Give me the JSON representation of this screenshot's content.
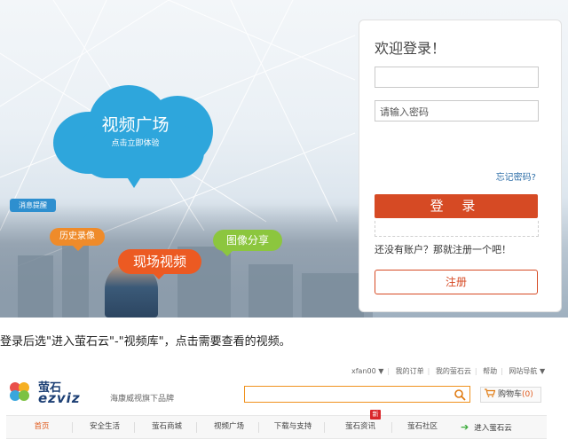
{
  "login_screenshot": {
    "cloud_title": "视频广场",
    "cloud_subtitle": "点击立即体验",
    "tags": {
      "message": "消息提醒",
      "history": "历史录像",
      "live": "现场视频",
      "share": "图像分享"
    },
    "panel": {
      "title": "欢迎登录！",
      "username_value": "",
      "password_placeholder": "请输入密码",
      "forgot_link": "忘记密码?",
      "login_button": "登 录",
      "no_account_text": "还没有账户？那就注册一个吧！",
      "register_button": "注册"
    }
  },
  "caption": "登录后选\"进入萤石云\"-\"视频库\"，点击需要查看的视频。",
  "portal": {
    "top_links": [
      "xfan00 ▼",
      "我的订单",
      "我的萤石云",
      "帮助",
      "网站导航 ▼"
    ],
    "logo_cn": "萤石",
    "logo_en": "ezviz",
    "slogan": "海康威视旗下品牌",
    "search_value": "",
    "cart_label": "购物车",
    "cart_count": "(0)",
    "nav": [
      "首页",
      "安全生活",
      "萤石商城",
      "视频广场",
      "下载与支持",
      "萤石资讯",
      "萤石社区"
    ],
    "nav_new_badge": "新",
    "enter_link": "进入萤石云",
    "colors": {
      "accent": "#e05b1e",
      "login_red": "#d64a24",
      "cloud_blue": "#2ea6dc",
      "search_border": "#f0921e",
      "brand_blue": "#1c3f74"
    },
    "icons": [
      "search-icon",
      "cart-icon",
      "arrow-right-icon",
      "ezviz-logo-icon"
    ]
  }
}
